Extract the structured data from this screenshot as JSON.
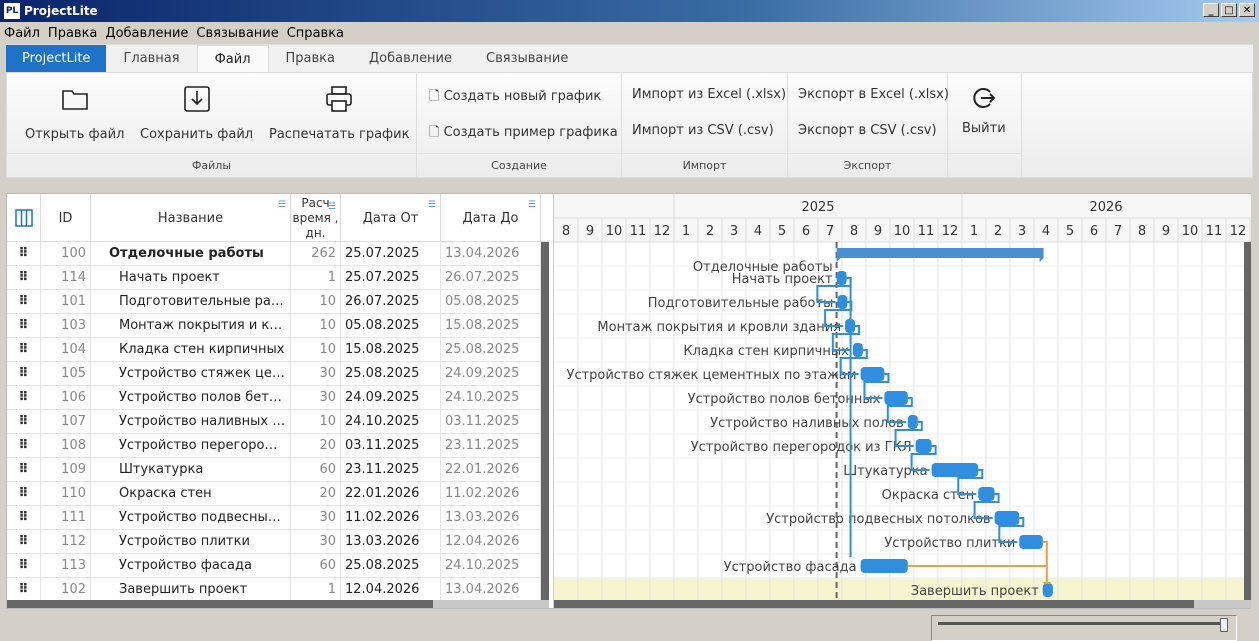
{
  "window": {
    "title": "ProjectLite",
    "logo": "PL"
  },
  "menu": [
    "Файл",
    "Правка",
    "Добавление",
    "Связывание",
    "Справка"
  ],
  "tabs": [
    "ProjectLite",
    "Главная",
    "Файл",
    "Правка",
    "Добавление",
    "Связывание"
  ],
  "ribbon": {
    "files": {
      "label": "Файлы",
      "open": "Открыть файл",
      "save": "Сохранить файл",
      "print": "Распечатать график"
    },
    "create": {
      "label": "Создание",
      "new": "Создать новый график",
      "sample": "Создать пример графика"
    },
    "import": {
      "label": "Импорт",
      "excel": "Импорт из Excel (.xlsx)",
      "csv": "Импорт из CSV (.csv)"
    },
    "export": {
      "label": "Экспорт",
      "excel": "Экспорт в Excel (.xlsx)",
      "csv": "Экспорт в CSV (.csv)"
    },
    "exit": "Выйти"
  },
  "columns": {
    "id": "ID",
    "name": "Название",
    "duration": "Расч время , дн.",
    "from": "Дата От",
    "to": "Дата До"
  },
  "tasks": [
    {
      "id": "100",
      "name": "Отделочные работы",
      "dur": "262",
      "from": "25.07.2025",
      "to": "13.04.2026",
      "summary": true
    },
    {
      "id": "114",
      "name": "Начать проект",
      "dur": "1",
      "from": "25.07.2025",
      "to": "26.07.2025"
    },
    {
      "id": "101",
      "name": "Подготовительные работы",
      "dur": "10",
      "from": "26.07.2025",
      "to": "05.08.2025"
    },
    {
      "id": "103",
      "name": "Монтаж покрытия и кровли здания",
      "dur": "10",
      "from": "05.08.2025",
      "to": "15.08.2025"
    },
    {
      "id": "104",
      "name": "Кладка стен кирпичных",
      "dur": "10",
      "from": "15.08.2025",
      "to": "25.08.2025"
    },
    {
      "id": "105",
      "name": "Устройство стяжек цементных по этажам",
      "dur": "30",
      "from": "25.08.2025",
      "to": "24.09.2025"
    },
    {
      "id": "106",
      "name": "Устройство полов бетонных",
      "dur": "30",
      "from": "24.09.2025",
      "to": "24.10.2025"
    },
    {
      "id": "107",
      "name": "Устройство наливных полов",
      "dur": "10",
      "from": "24.10.2025",
      "to": "03.11.2025"
    },
    {
      "id": "108",
      "name": "Устройство перегородок из ГКЛ",
      "dur": "20",
      "from": "03.11.2025",
      "to": "23.11.2025"
    },
    {
      "id": "109",
      "name": "Штукатурка",
      "dur": "60",
      "from": "23.11.2025",
      "to": "22.01.2026"
    },
    {
      "id": "110",
      "name": "Окраска стен",
      "dur": "20",
      "from": "22.01.2026",
      "to": "11.02.2026"
    },
    {
      "id": "111",
      "name": "Устройство подвесных потолков",
      "dur": "30",
      "from": "11.02.2026",
      "to": "13.03.2026"
    },
    {
      "id": "112",
      "name": "Устройство плитки",
      "dur": "30",
      "from": "13.03.2026",
      "to": "12.04.2026"
    },
    {
      "id": "113",
      "name": "Устройство фасада",
      "dur": "60",
      "from": "25.08.2025",
      "to": "24.10.2025"
    },
    {
      "id": "102",
      "name": "Завершить проект",
      "dur": "1",
      "from": "12.04.2026",
      "to": "13.04.2026"
    }
  ],
  "timeline": {
    "years": [
      "2025",
      "2026"
    ],
    "months": [
      "8",
      "9",
      "10",
      "11",
      "12",
      "1",
      "2",
      "3",
      "4",
      "5",
      "6",
      "7",
      "8",
      "9",
      "10",
      "11",
      "12",
      "1",
      "2",
      "3",
      "4",
      "5",
      "6",
      "7",
      "8",
      "9",
      "10",
      "11",
      "12"
    ],
    "today": "25.07.2025"
  },
  "colors": {
    "accent": "#1e73c8",
    "bar": "#2f8ee0",
    "critical": "#e8a040",
    "highlight": "#f7f5d0"
  }
}
